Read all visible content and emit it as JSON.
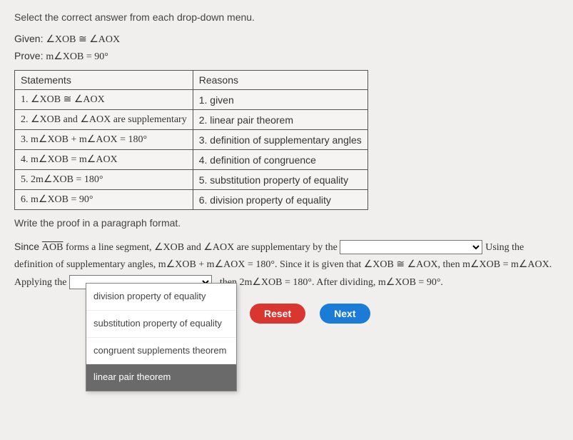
{
  "instruction": "Select the correct answer from each drop-down menu.",
  "given_label": "Given:",
  "given_expr": "∠XOB ≅ ∠AOX",
  "prove_label": "Prove:",
  "prove_expr": "m∠XOB = 90°",
  "table": {
    "headers": [
      "Statements",
      "Reasons"
    ],
    "rows": [
      [
        "1. ∠XOB ≅ ∠AOX",
        "1. given"
      ],
      [
        "2. ∠XOB and ∠AOX are supplementary",
        "2. linear pair theorem"
      ],
      [
        "3. m∠XOB + m∠AOX = 180°",
        "3. definition of supplementary angles"
      ],
      [
        "4. m∠XOB = m∠AOX",
        "4. definition of congruence"
      ],
      [
        "5. 2m∠XOB = 180°",
        "5. substitution property of equality"
      ],
      [
        "6. m∠XOB = 90°",
        "6. division property of equality"
      ]
    ]
  },
  "write_paragraph": "Write the proof in a paragraph format.",
  "para": {
    "p1a": "Since ",
    "p1b": "AOB",
    "p1c": " forms a line segment, ∠XOB and ∠AOX are supplementary by the ",
    "p2": " Using the definition of supplementary angles, m∠XOB + m∠AOX = 180°. Since it is given that ∠XOB ≅ ∠AOX, then m∠XOB = m∠AOX. Applying the ",
    "p3": " , then 2m∠XOB = 180°. After dividing, m∠XOB = 90°."
  },
  "dropdown_options": [
    "division property of equality",
    "substitution property of equality",
    "congruent supplements theorem",
    "linear pair theorem"
  ],
  "buttons": {
    "reset": "Reset",
    "next": "Next"
  }
}
